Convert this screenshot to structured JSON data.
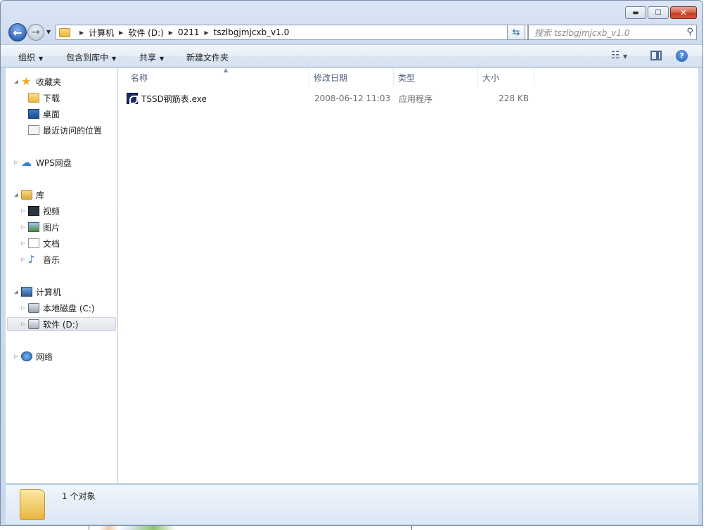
{
  "window": {
    "caption": {
      "minimize": "▬",
      "maximize": "☐",
      "close": "✕"
    }
  },
  "address_bar": {
    "crumbs": [
      "计算机",
      "软件 (D:)",
      "0211",
      "tszlbgjmjcxb_v1.0"
    ]
  },
  "search": {
    "placeholder": "搜索 tszlbgjmjcxb_v1.0"
  },
  "toolbar": {
    "organize": "组织",
    "include_in_library": "包含到库中",
    "share": "共享",
    "new_folder": "新建文件夹"
  },
  "nav_pane": {
    "favorites": "收藏夹",
    "downloads": "下载",
    "desktop": "桌面",
    "recent": "最近访问的位置",
    "wps_cloud": "WPS网盘",
    "libraries": "库",
    "videos": "视频",
    "pictures": "图片",
    "documents": "文档",
    "music": "音乐",
    "computer": "计算机",
    "drive_c": "本地磁盘 (C:)",
    "drive_d": "软件 (D:)",
    "network": "网络"
  },
  "columns": {
    "name": "名称",
    "modified": "修改日期",
    "type": "类型",
    "size": "大小"
  },
  "files": [
    {
      "name": "TSSD钢筋表.exe",
      "modified": "2008-06-12 11:03",
      "type": "应用程序",
      "size": "228 KB"
    }
  ],
  "status": {
    "count_text": "1 个对象"
  }
}
